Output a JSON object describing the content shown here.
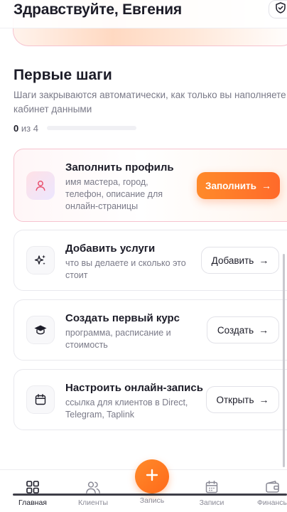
{
  "header": {
    "greeting": "Здравствуйте, Евгения",
    "shield_icon": "shield-check-icon"
  },
  "onboarding": {
    "title": "Первые шаги",
    "description": "Шаги закрываются автоматически, как только вы наполняете кабинет данными",
    "progress_done": "0",
    "progress_total_text": "из 4",
    "progress_fraction": 0
  },
  "steps": [
    {
      "title": "Заполнить профиль",
      "description": "имя мастера, город, телефон, описание для онлайн-страницы",
      "button_label": "Заполнить",
      "icon": "user-icon"
    },
    {
      "title": "Добавить услуги",
      "description": "что вы делаете и сколько это стоит",
      "button_label": "Добавить",
      "icon": "sparkles-icon"
    },
    {
      "title": "Создать первый курс",
      "description": "программа, расписание и стоимость",
      "button_label": "Создать",
      "icon": "graduation-cap-icon"
    },
    {
      "title": "Настроить онлайн-запись",
      "description": "ссылка для клиентов в Direct, Telegram, Taplink",
      "button_label": "Открыть",
      "icon": "calendar-icon"
    }
  ],
  "arrow_glyph": "→",
  "tabbar": {
    "items": [
      {
        "label": "Главная",
        "icon": "grid-icon"
      },
      {
        "label": "Клиенты",
        "icon": "users-icon"
      },
      {
        "label": "Запись",
        "icon": "plus-icon"
      },
      {
        "label": "Записи",
        "icon": "calendar-icon"
      },
      {
        "label": "Финансы",
        "icon": "wallet-icon"
      }
    ]
  },
  "colors": {
    "accent": "#ff7a2e",
    "text": "#1c1c28",
    "muted": "#7a7a88",
    "active_border": "#f6c3cf"
  }
}
